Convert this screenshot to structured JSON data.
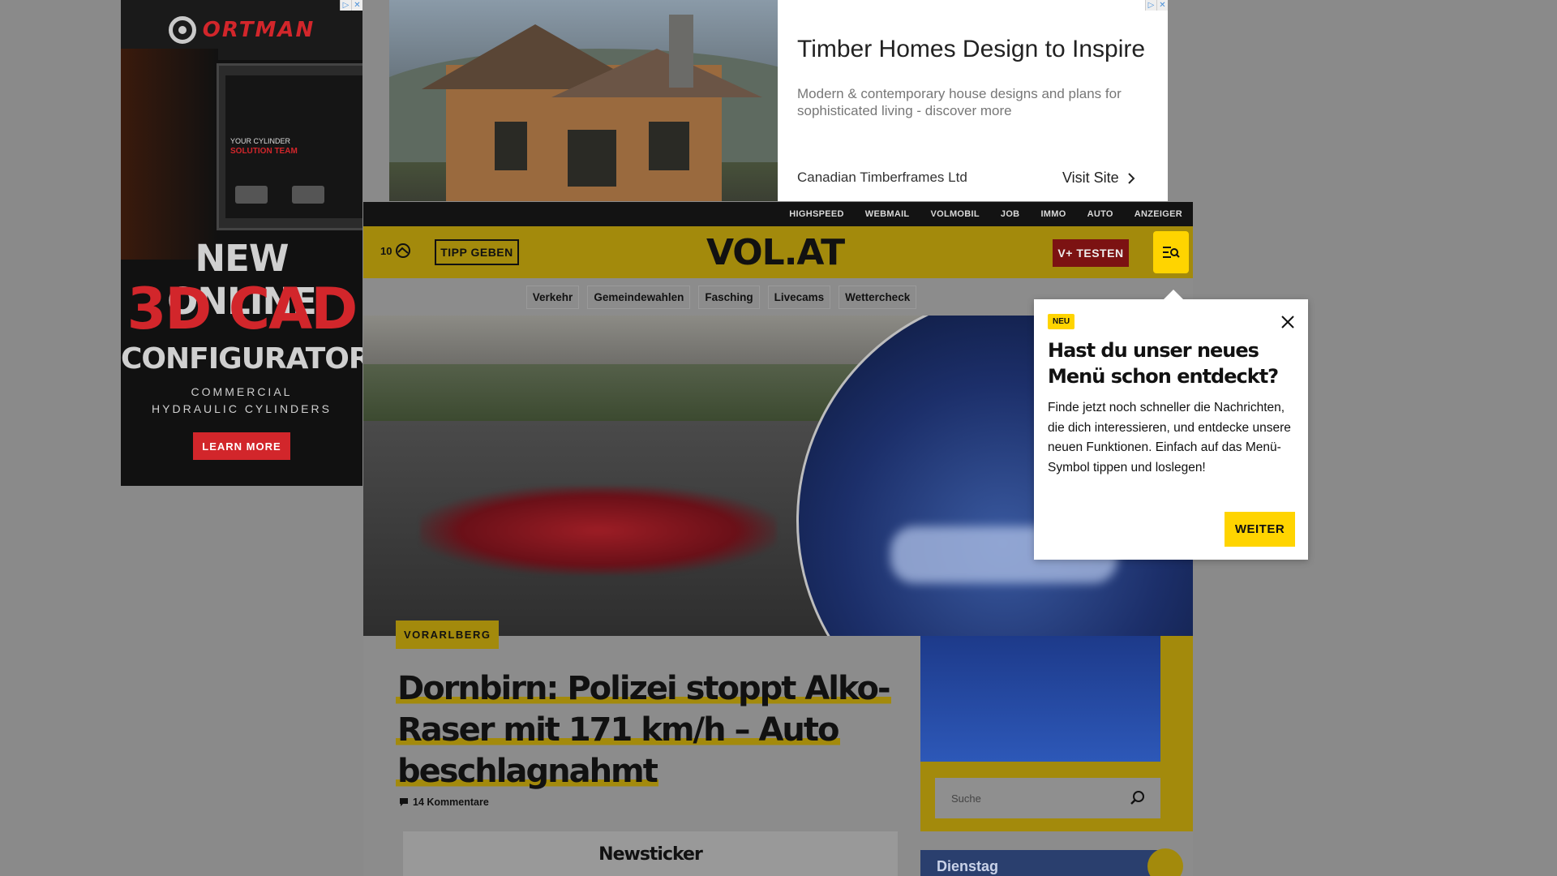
{
  "ad_left": {
    "brand": "ORTMAN",
    "screen_line1": "YOUR CYLINDER",
    "screen_line2": "SOLUTION TEAM",
    "headline1": "NEW ONLINE",
    "headline2": "3D CAD",
    "headline3": "CONFIGURATOR",
    "sub1": "COMMERCIAL",
    "sub2": "HYDRAULIC CYLINDERS",
    "cta": "LEARN MORE"
  },
  "ad_top": {
    "title": "Timber Homes Design to Inspire",
    "description": "Modern & contemporary house designs and plans for sophisticated living - discover more",
    "advertiser": "Canadian Timberframes Ltd",
    "cta": "Visit Site"
  },
  "topnav": [
    "HIGHSPEED",
    "WEBMAIL",
    "VOLMOBIL",
    "JOB",
    "IMMO",
    "AUTO",
    "ANZEIGER"
  ],
  "header": {
    "count": "10",
    "tipp": "TIPP GEBEN",
    "logo": "VOL.AT",
    "vplus": "V+ TESTEN"
  },
  "subnav": [
    "Verkehr",
    "Gemeindewahlen",
    "Fasching",
    "Livecams",
    "Wettercheck"
  ],
  "article": {
    "tag": "VORARLBERG",
    "headline": "Dornbirn: Polizei stoppt Alko-Raser mit 171 km/h – Auto beschlagnahmt",
    "comments": "14 Kommentare"
  },
  "newsticker": "Newsticker",
  "search": {
    "placeholder": "Suche"
  },
  "weather": {
    "day": "Dienstag"
  },
  "popup": {
    "badge": "NEU",
    "title": "Hast du unser neues Menü schon entdeckt?",
    "body": "Finde jetzt noch schneller die Nachrichten, die dich interessieren, und entdecke unsere neuen Funktionen. Einfach auf das Menü-Symbol tippen und loslegen!",
    "button": "WEITER"
  },
  "colors": {
    "brand_yellow": "#ffd400",
    "overlay_dim": "#8c8c8c",
    "ad_red": "#d2262b"
  }
}
